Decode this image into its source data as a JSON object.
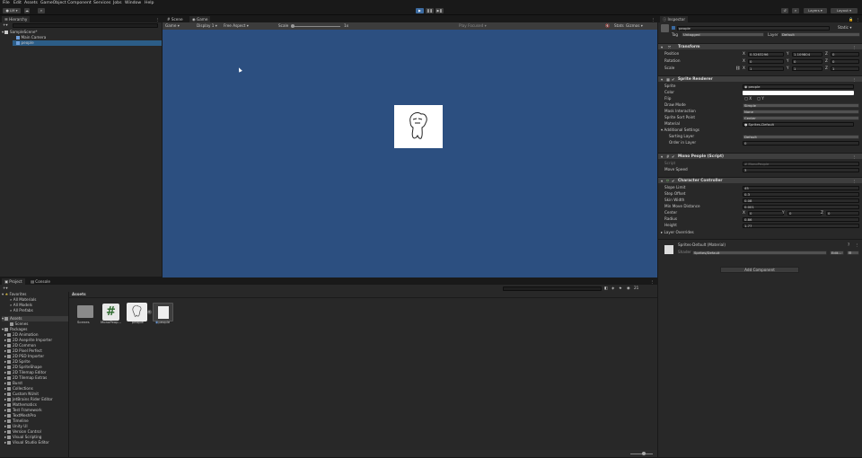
{
  "menu": [
    "File",
    "Edit",
    "Assets",
    "GameObject",
    "Component",
    "Services",
    "Jobs",
    "Window",
    "Help"
  ],
  "toolbar": {
    "account": "LM",
    "layers": "Layers",
    "layout": "Layout"
  },
  "hierarchy": {
    "tab": "Hierarchy",
    "scene": "SampleScene*",
    "items": [
      "Main Camera",
      "people"
    ]
  },
  "scene_tab": "Scene",
  "game_tab": "Game",
  "game_toolbar": {
    "mode": "Game",
    "display": "Display 1",
    "aspect": "Free Aspect",
    "scale_label": "Scale",
    "scale_value": "1x",
    "play_focused": "Play Focused",
    "stats": "Stats",
    "gizmos": "Gizmos"
  },
  "project": {
    "tab": "Project",
    "console_tab": "Console",
    "favorites": "Favorites",
    "fav_items": [
      "All Materials",
      "All Models",
      "All Prefabs"
    ],
    "assets": "Assets",
    "scenes": "Scenes",
    "packages": "Packages",
    "packages_list": [
      "2D Animation",
      "2D Aseprite Importer",
      "2D Common",
      "2D Pixel Perfect",
      "2D PSD Importer",
      "2D Sprite",
      "2D SpriteShape",
      "2D Tilemap Editor",
      "2D Tilemap Extras",
      "Burst",
      "Collections",
      "Custom NUnit",
      "JetBrains Rider Editor",
      "Mathematics",
      "Test Framework",
      "TextMeshPro",
      "Timeline",
      "Unity UI",
      "Version Control",
      "Visual Scripting",
      "Visual Studio Editor"
    ],
    "breadcrumb": "Assets",
    "count": "21",
    "grid_items": [
      "Scenes",
      "MonoPeop...",
      "people",
      "people"
    ]
  },
  "inspector": {
    "tab": "Inspector",
    "name": "people",
    "static": "Static",
    "tag_label": "Tag",
    "tag": "Untagged",
    "layer_label": "Layer",
    "layer": "Default",
    "transform": {
      "title": "Transform",
      "rows": [
        {
          "label": "Position",
          "x": "0.5263296",
          "y": "1.109804",
          "z": "0"
        },
        {
          "label": "Rotation",
          "x": "0",
          "y": "0",
          "z": "0"
        },
        {
          "label": "Scale",
          "x": "1",
          "y": "1",
          "z": "1"
        }
      ]
    },
    "sprite_renderer": {
      "title": "Sprite Renderer",
      "sprite_label": "Sprite",
      "sprite": "people",
      "color_label": "Color",
      "flip_label": "Flip",
      "flip_x": "X",
      "flip_y": "Y",
      "draw_mode_label": "Draw Mode",
      "draw_mode": "Simple",
      "mask_label": "Mask Interaction",
      "mask": "None",
      "sort_point_label": "Sprite Sort Point",
      "sort_point": "Center",
      "material_label": "Material",
      "material": "Sprites-Default",
      "additional": "Additional Settings",
      "sorting_layer_label": "Sorting Layer",
      "sorting_layer": "Default",
      "order_label": "Order in Layer",
      "order": "0"
    },
    "mono": {
      "title": "Mono People (Script)",
      "script_label": "Script",
      "script": "MonoPeople",
      "speed_label": "Move Speed",
      "speed": "3"
    },
    "cc": {
      "title": "Character Controller",
      "rows": [
        [
          "Slope Limit",
          "45"
        ],
        [
          "Step Offset",
          "0.3"
        ],
        [
          "Skin Width",
          "0.08"
        ],
        [
          "Min Move Distance",
          "0.001"
        ]
      ],
      "center_label": "Center",
      "center": [
        "0",
        "0",
        "0"
      ],
      "radius_label": "Radius",
      "radius": "0.86",
      "height_label": "Height",
      "height": "1.77",
      "layer_overrides": "Layer Overrides"
    },
    "material_block": {
      "title": "Sprites-Default (Material)",
      "shader_label": "Shader",
      "shader": "Sprites/Default",
      "edit": "Edit...",
      "more": "☰"
    },
    "add_component": "Add Component"
  }
}
